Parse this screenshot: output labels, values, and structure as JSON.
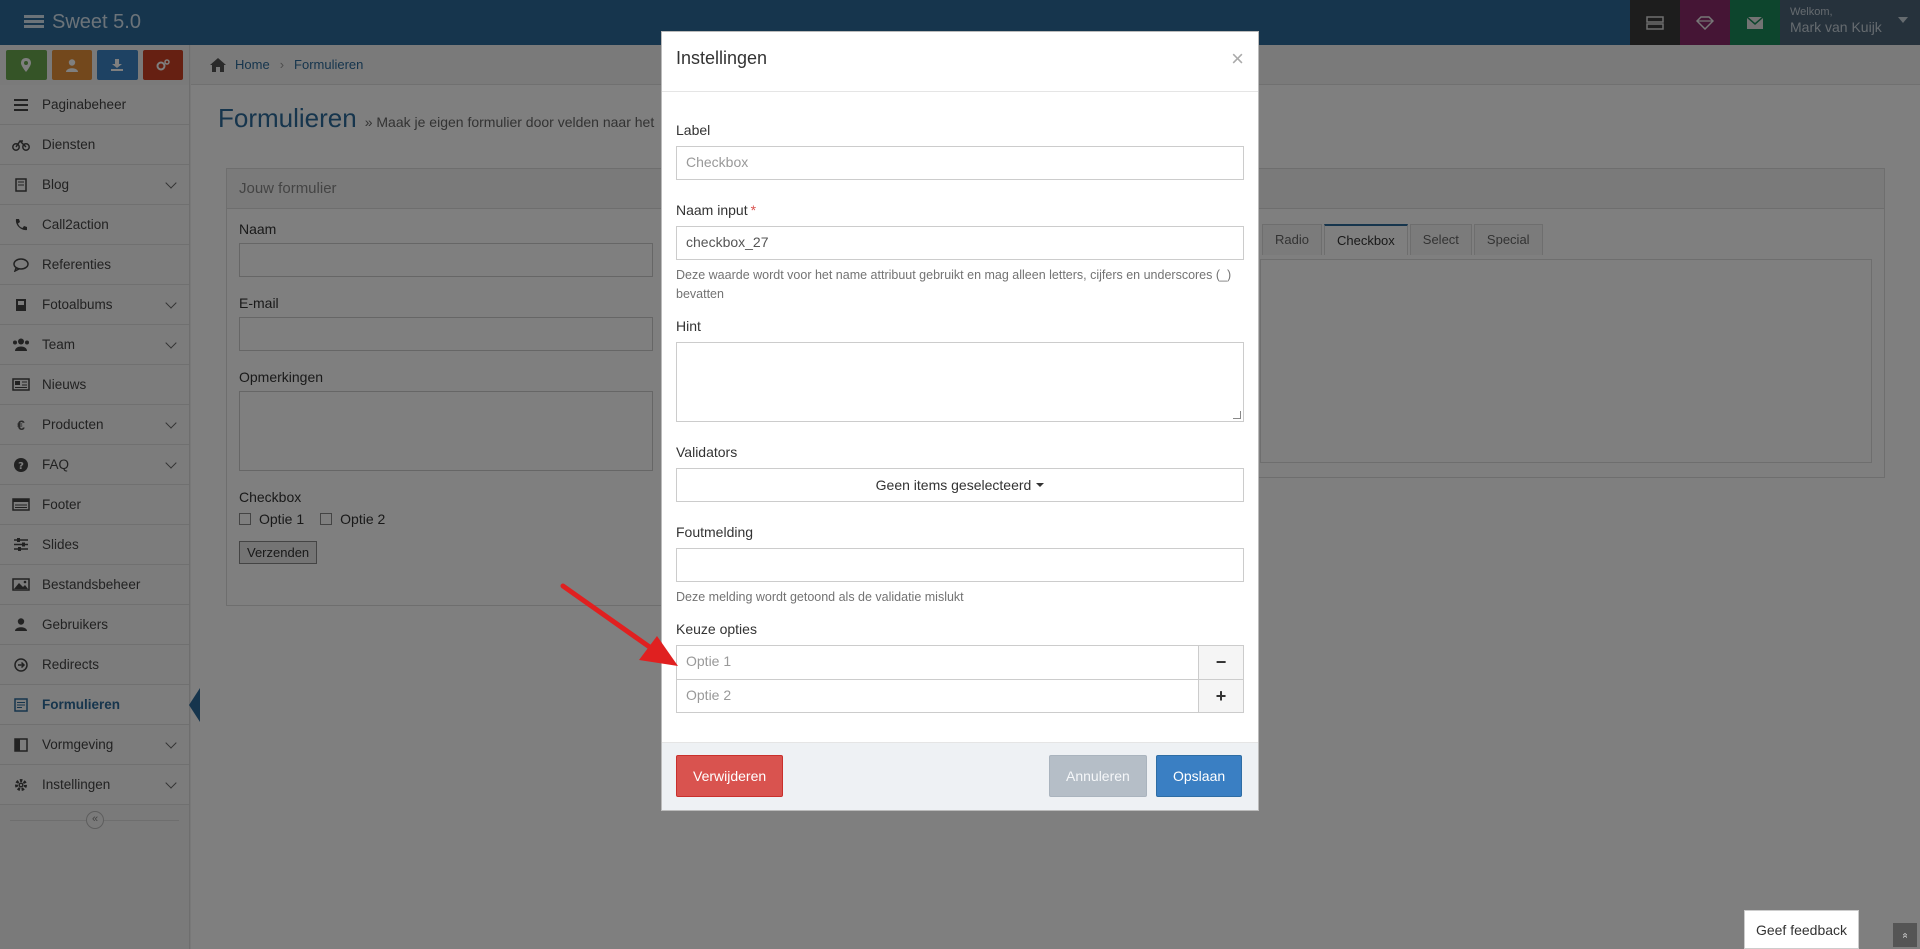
{
  "app": {
    "title": "Sweet 5.0"
  },
  "topbar": {
    "welcome": "Welkom,",
    "user_name": "Mark van Kuijk",
    "icons": [
      "server-icon",
      "diamond-icon",
      "mail-icon"
    ]
  },
  "colors": {
    "topbar": "#2d6a9a",
    "accent": "#2d6a9a",
    "delete": "#d9534f",
    "save": "#3a7fc3",
    "cancel": "#b5bec7"
  },
  "sidebar": {
    "shortcuts": [
      "map-marker-icon",
      "user-icon",
      "download-icon",
      "cogs-icon"
    ],
    "items": [
      {
        "label": "Paginabeheer",
        "icon": "bars-icon",
        "has_children": false
      },
      {
        "label": "Diensten",
        "icon": "bicycle-icon",
        "has_children": false
      },
      {
        "label": "Blog",
        "icon": "book-icon",
        "has_children": true
      },
      {
        "label": "Call2action",
        "icon": "phone-icon",
        "has_children": false
      },
      {
        "label": "Referenties",
        "icon": "comment-icon",
        "has_children": false
      },
      {
        "label": "Fotoalbums",
        "icon": "album-icon",
        "has_children": true
      },
      {
        "label": "Team",
        "icon": "users-icon",
        "has_children": true
      },
      {
        "label": "Nieuws",
        "icon": "newspaper-icon",
        "has_children": false
      },
      {
        "label": "Producten",
        "icon": "euro-icon",
        "has_children": true
      },
      {
        "label": "FAQ",
        "icon": "question-icon",
        "has_children": true
      },
      {
        "label": "Footer",
        "icon": "footer-icon",
        "has_children": false
      },
      {
        "label": "Slides",
        "icon": "sliders-icon",
        "has_children": false
      },
      {
        "label": "Bestandsbeheer",
        "icon": "image-icon",
        "has_children": false
      },
      {
        "label": "Gebruikers",
        "icon": "user-icon",
        "has_children": false
      },
      {
        "label": "Redirects",
        "icon": "arrow-circle-icon",
        "has_children": false
      },
      {
        "label": "Formulieren",
        "icon": "form-icon",
        "has_children": false,
        "active": true
      },
      {
        "label": "Vormgeving",
        "icon": "layout-icon",
        "has_children": true
      },
      {
        "label": "Instellingen",
        "icon": "gear-icon",
        "has_children": true
      }
    ],
    "collapse_label": "«"
  },
  "breadcrumb": {
    "home": "Home",
    "current": "Formulieren"
  },
  "page": {
    "title": "Formulieren",
    "subtitle": "» Maak je eigen formulier door velden naar het"
  },
  "form_preview": {
    "panel_title": "Jouw formulier",
    "fields": [
      "Naam",
      "E-mail",
      "Opmerkingen"
    ],
    "checkbox_label": "Checkbox",
    "checkbox_options": [
      "Optie 1",
      "Optie 2"
    ],
    "submit": "Verzenden"
  },
  "field_tabs": {
    "tabs": [
      "Radio",
      "Checkbox",
      "Select",
      "Special"
    ],
    "active": "Checkbox"
  },
  "modal": {
    "title": "Instellingen",
    "close": "×",
    "label_label": "Label",
    "label_value": "Checkbox",
    "name_label": "Naam input",
    "required_mark": "*",
    "name_value": "checkbox_27",
    "name_help": "Deze waarde wordt voor het name attribuut gebruikt en mag alleen letters, cijfers en underscores (_) bevatten",
    "hint_label": "Hint",
    "hint_value": "",
    "validators_label": "Validators",
    "validators_value": "Geen items geselecteerd",
    "error_label": "Foutmelding",
    "error_value": "",
    "error_help": "Deze melding wordt getoond als de validatie mislukt",
    "options_label": "Keuze opties",
    "options": [
      {
        "placeholder": "Optie 1",
        "action": "−"
      },
      {
        "placeholder": "Optie 2",
        "action": "+"
      }
    ],
    "delete_button": "Verwijderen",
    "cancel_button": "Annuleren",
    "save_button": "Opslaan"
  },
  "feedback": {
    "label": "Geef feedback",
    "scroll_top": "»"
  }
}
